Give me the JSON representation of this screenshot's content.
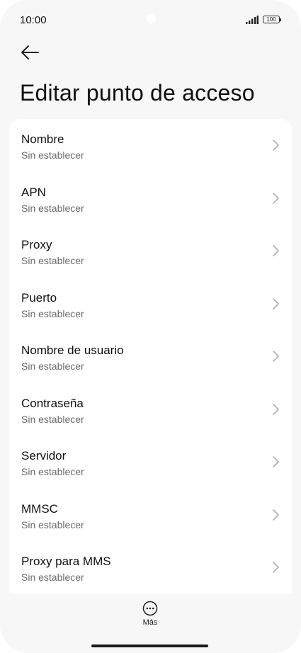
{
  "status": {
    "time": "10:00",
    "battery": "100"
  },
  "header": {
    "title": "Editar punto de acceso"
  },
  "fields": [
    {
      "label": "Nombre",
      "value": "Sin establecer"
    },
    {
      "label": "APN",
      "value": "Sin establecer"
    },
    {
      "label": "Proxy",
      "value": "Sin establecer"
    },
    {
      "label": "Puerto",
      "value": "Sin establecer"
    },
    {
      "label": "Nombre de usuario",
      "value": "Sin establecer"
    },
    {
      "label": "Contraseña",
      "value": "Sin establecer"
    },
    {
      "label": "Servidor",
      "value": "Sin establecer"
    },
    {
      "label": "MMSC",
      "value": "Sin establecer"
    },
    {
      "label": "Proxy para MMS",
      "value": "Sin establecer"
    }
  ],
  "footer": {
    "more_label": "Más"
  },
  "icons": {
    "back": "arrow-left-icon",
    "chevron": "chevron-right-icon",
    "more": "more-horizontal-icon"
  }
}
